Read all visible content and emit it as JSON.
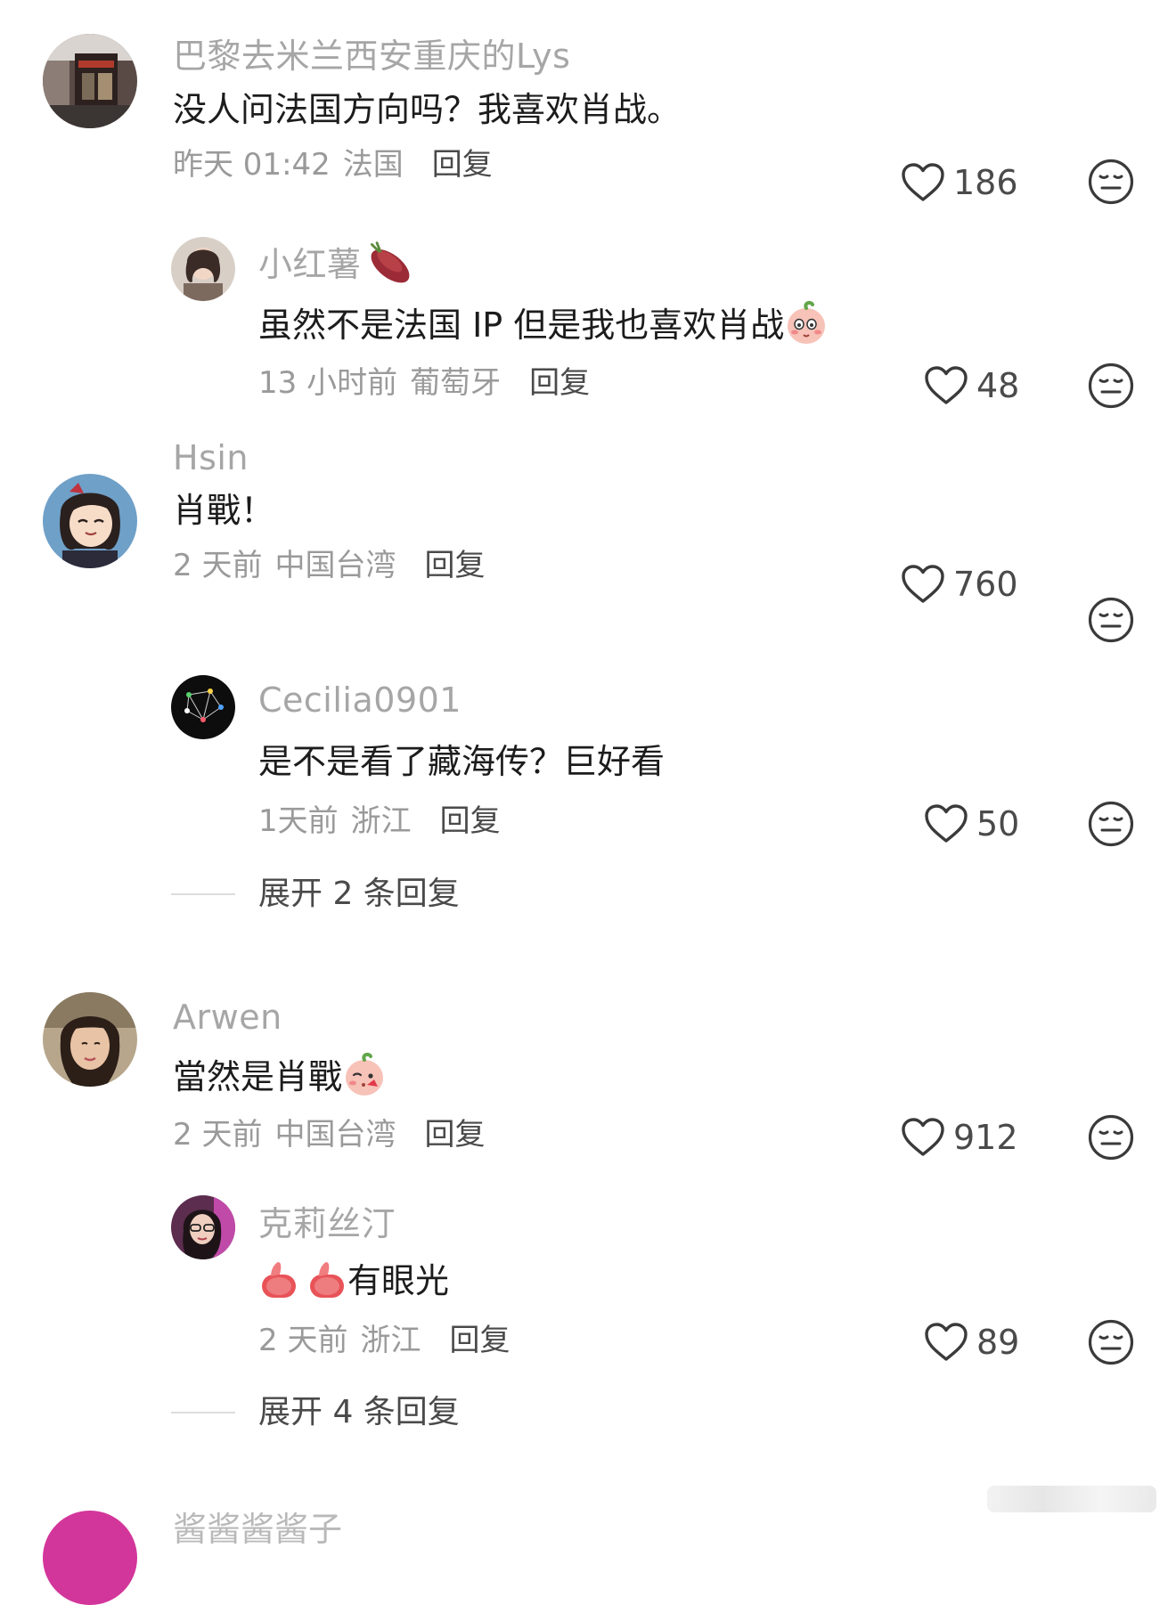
{
  "comments": [
    {
      "username": "巴黎去米兰西安重庆的Lys",
      "text": "没人问法国方向吗？我喜欢肖战。",
      "time": "昨天 01:42",
      "location": "法国",
      "reply_label": "回复",
      "likes": "186",
      "avatar_icon": "avatar-storefront",
      "replies": [
        {
          "username": "小红薯",
          "name_emoji": "sweet-potato-icon",
          "text": "虽然不是法国 IP 但是我也喜欢肖战",
          "text_emoji": "peach-blush-emoji",
          "time": "13 小时前",
          "location": "葡萄牙",
          "reply_label": "回复",
          "likes": "48"
        }
      ]
    },
    {
      "username": "Hsin",
      "text": "肖戰！",
      "time": "2 天前",
      "location": "中国台湾",
      "reply_label": "回复",
      "likes": "760",
      "avatar_icon": "avatar-cartoon-girl",
      "replies": [
        {
          "username": "Cecilia0901",
          "text": "是不是看了藏海传？巨好看",
          "time": "1天前",
          "location": "浙江",
          "reply_label": "回复",
          "likes": "50"
        }
      ],
      "expand_label": "展开 2 条回复"
    },
    {
      "username": "Arwen",
      "text": "當然是肖戰",
      "text_emoji": "peach-kiss-emoji",
      "time": "2 天前",
      "location": "中国台湾",
      "reply_label": "回复",
      "likes": "912",
      "avatar_icon": "avatar-woman",
      "replies": [
        {
          "username": "克莉丝汀",
          "text_prefix_emojis": [
            "thumbs-up-emoji",
            "thumbs-up-emoji"
          ],
          "text": "有眼光",
          "time": "2 天前",
          "location": "浙江",
          "reply_label": "回复",
          "likes": "89"
        }
      ],
      "expand_label": "展开 4 条回复"
    }
  ],
  "next_comment_partial": {
    "username": "酱酱酱酱子"
  },
  "colors": {
    "username": "#a6a6a6",
    "body": "#1c1c1c",
    "meta": "#9a9a9a",
    "action": "#4a4a4a",
    "background": "#ffffff"
  }
}
